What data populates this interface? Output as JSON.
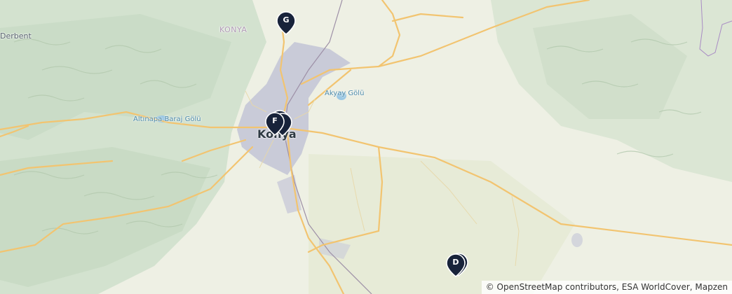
{
  "map": {
    "labels": {
      "region": "KONYA",
      "town_west": "Derbent",
      "lake_west": "Altınapa Baraj Gölü",
      "lake_east": "Akyay Gölü",
      "city": "Konya"
    },
    "markers": {
      "g": "G",
      "f": "F",
      "d": "D"
    },
    "attribution": "© OpenStreetMap contributors, ESA WorldCover, Mapzen",
    "colors": {
      "terrain_base": "#eef0e4",
      "forest_hills": "#c7d9c4",
      "road": "#f2c470",
      "urban": "#c9cbd8",
      "water": "#9cc8e4",
      "marker": "#18233a"
    }
  }
}
